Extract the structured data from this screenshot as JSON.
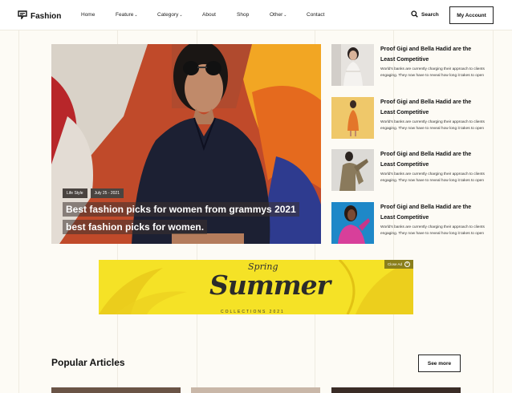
{
  "header": {
    "logo_text": "Fashion",
    "nav": [
      {
        "label": "Home",
        "dropdown": false
      },
      {
        "label": "Feature",
        "dropdown": true
      },
      {
        "label": "Category",
        "dropdown": true
      },
      {
        "label": "About",
        "dropdown": false
      },
      {
        "label": "Shop",
        "dropdown": false
      },
      {
        "label": "Other",
        "dropdown": true
      },
      {
        "label": "Contact",
        "dropdown": false
      }
    ],
    "search_label": "Search",
    "account_label": "My Account"
  },
  "hero": {
    "category": "Life Style",
    "date": "July 25 - 2021",
    "title": "Best fashion picks for women from grammys 2021 best fashion picks for women."
  },
  "side_articles": [
    {
      "title": "Proof Gigi and Bella Hadid are the Least Competitive",
      "desc": "World's banks are currently charging their approach to clients engaging. They now have to reveal how long it takes to open",
      "theme": "white-outfit"
    },
    {
      "title": "Proof Gigi and Bella Hadid are the Least Competitive",
      "desc": "World's banks are currently charging their approach to clients engaging. They now have to reveal how long it takes to open",
      "theme": "orange-dress"
    },
    {
      "title": "Proof Gigi and Bella Hadid are the Least Competitive",
      "desc": "World's banks are currently charging their approach to clients engaging. They now have to reveal how long it takes to open",
      "theme": "khaki-coat"
    },
    {
      "title": "Proof Gigi and Bella Hadid are the Least Competitive",
      "desc": "World's banks are currently charging their approach to clients engaging. They now have to reveal how long it takes to open",
      "theme": "pink-blue"
    }
  ],
  "ad_banner": {
    "close_label": "Close Ad",
    "kicker": "Spring",
    "headline": "Summer",
    "subline": "COLLECTIONS 2021"
  },
  "popular": {
    "title": "Popular Articles",
    "see_more_label": "See more"
  },
  "icons": {
    "logo": "logo-mark-icon",
    "search": "search-icon",
    "close": "close-icon"
  },
  "colors": {
    "page_bg": "#fdfbf5",
    "banner_yellow": "#f5e226",
    "text_dark": "#111111"
  }
}
